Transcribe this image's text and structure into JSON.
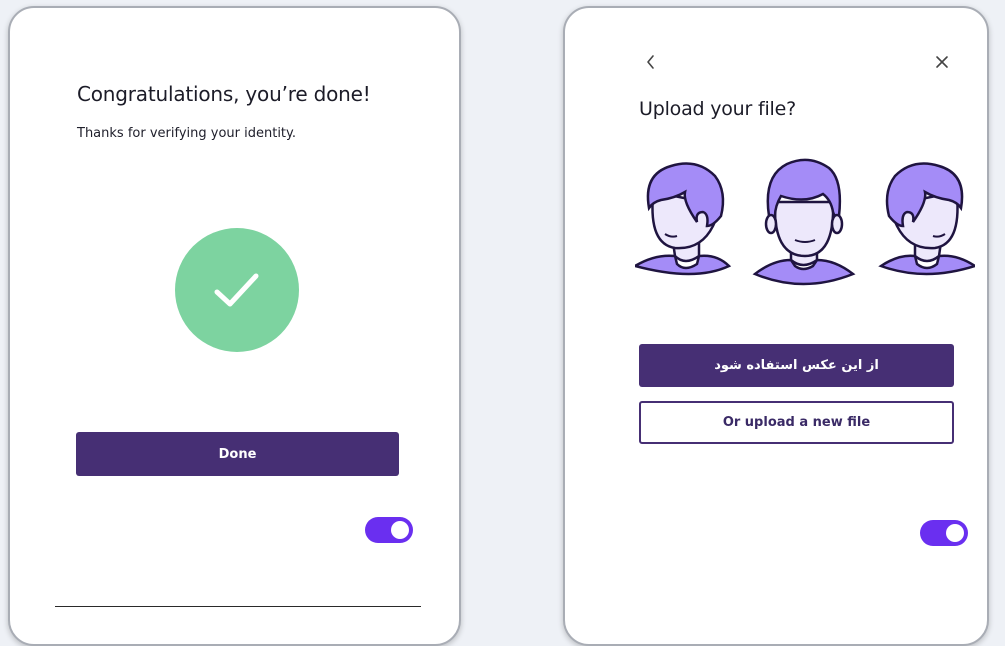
{
  "colors": {
    "page_background": "#eef1f6",
    "primary_button": "#462f74",
    "success_green": "#7dd3a0",
    "toggle_on": "#6a2ff0",
    "avatar_hair": "#a48cf7",
    "avatar_face": "#ede8fb"
  },
  "left_card": {
    "title": "Congratulations, you’re done!",
    "subtitle": "Thanks for verifying your identity.",
    "success_icon": "checkmark-icon",
    "done_button": "Done",
    "toggle_on": true
  },
  "right_card": {
    "back_icon": "chevron-left-icon",
    "close_icon": "close-icon",
    "title": "Upload your file?",
    "illustration": [
      "avatar-left-profile",
      "avatar-front",
      "avatar-right-profile"
    ],
    "use_photo_button": "از این عکس استفاده شود",
    "upload_new_button": "Or upload a new file",
    "toggle_on": true
  }
}
